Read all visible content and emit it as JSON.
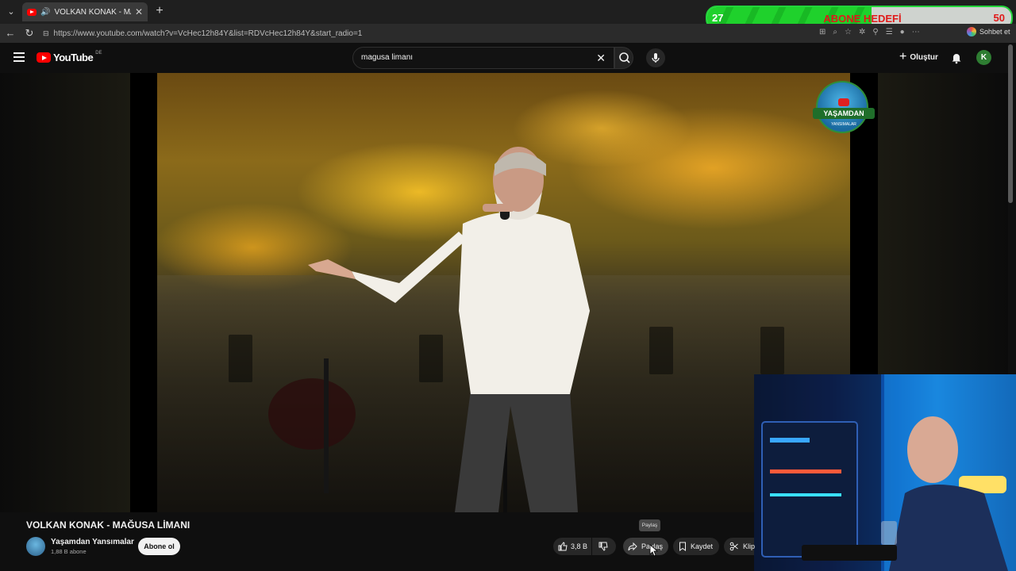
{
  "browser": {
    "tab_title": "VOLKAN KONAK - MAĞUSA L",
    "url": "https://www.youtube.com/watch?v=VcHec12h84Y&list=RDVcHec12h84Y&start_radio=1",
    "chat_label": "Sohbet et"
  },
  "overlay_goal": {
    "current": "27",
    "label": "ABONE HEDEFİ",
    "target": "50",
    "progress_fraction": 0.54
  },
  "youtube": {
    "logo_text": "YouTube",
    "country_code": "DE",
    "search_query": "magusa limanı",
    "create_label": "Oluştur",
    "avatar_letter": "K"
  },
  "video": {
    "title": "VOLKAN KONAK - MAĞUSA LİMANI",
    "channel_logo_text": "YAŞAMDAN",
    "channel_logo_sub": "YANSIMALAR"
  },
  "channel": {
    "name": "Yaşamdan Yansımalar",
    "subscribers": "1,88 B abone",
    "subscribe_label": "Abone ol"
  },
  "actions": {
    "likes": "3,8 B",
    "share_label": "Paylaş",
    "share_tooltip": "Paylaş",
    "save_label": "Kaydet",
    "clip_label": "Klip"
  },
  "colors": {
    "youtube_red": "#ff0000",
    "goal_green": "#1fd12c",
    "goal_red": "#e01919"
  }
}
